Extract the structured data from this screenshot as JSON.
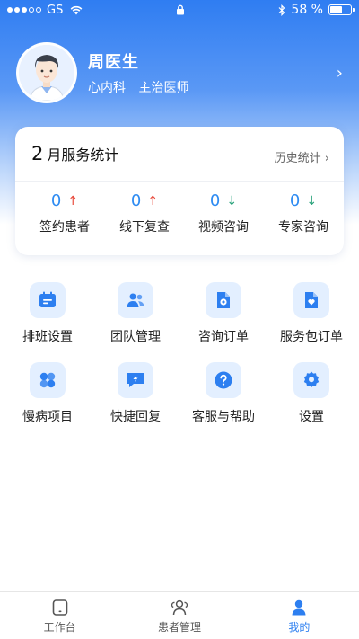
{
  "status_bar": {
    "carrier": "GS",
    "battery": "58 %",
    "battery_level": 0.58
  },
  "profile": {
    "name": "周医生",
    "department": "心内科",
    "title": "主治医师"
  },
  "stats": {
    "month": "2",
    "heading": "月服务统计",
    "history_label": "历史统计",
    "items": [
      {
        "value": "0",
        "trend": "up",
        "label": "签约患者"
      },
      {
        "value": "0",
        "trend": "up",
        "label": "线下复查"
      },
      {
        "value": "0",
        "trend": "down",
        "label": "视频咨询"
      },
      {
        "value": "0",
        "trend": "down",
        "label": "专家咨询"
      }
    ]
  },
  "menu": [
    {
      "label": "排班设置",
      "icon": "calendar-icon"
    },
    {
      "label": "团队管理",
      "icon": "team-icon"
    },
    {
      "label": "咨询订单",
      "icon": "consult-order-icon"
    },
    {
      "label": "服务包订单",
      "icon": "service-package-icon"
    },
    {
      "label": "慢病项目",
      "icon": "chronic-disease-icon"
    },
    {
      "label": "快捷回复",
      "icon": "quick-reply-icon"
    },
    {
      "label": "客服与帮助",
      "icon": "help-icon"
    },
    {
      "label": "设置",
      "icon": "gear-icon"
    }
  ],
  "tabs": [
    {
      "label": "工作台",
      "icon": "workbench-icon",
      "active": false
    },
    {
      "label": "患者管理",
      "icon": "patients-icon",
      "active": false
    },
    {
      "label": "我的",
      "icon": "profile-icon",
      "active": true
    }
  ],
  "colors": {
    "accent": "#2d7ff0",
    "up": "#e84a3c",
    "down": "#27a27a"
  }
}
